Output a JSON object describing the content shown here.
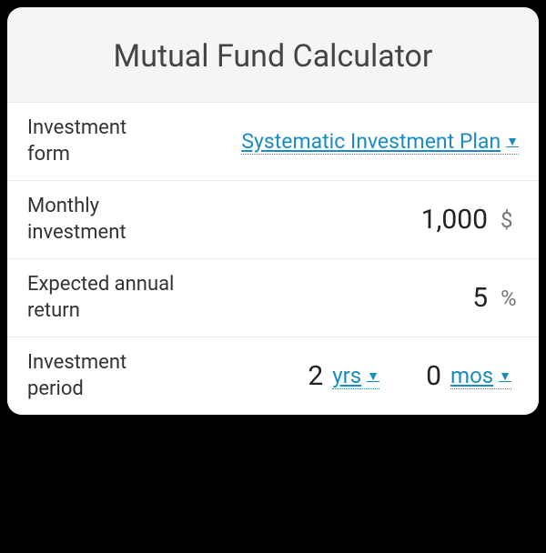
{
  "title": "Mutual Fund Calculator",
  "rows": {
    "form": {
      "label": "Investment form",
      "value": "Systematic Investment Plan"
    },
    "monthly": {
      "label": "Monthly investment",
      "value": "1,000",
      "unit": "$"
    },
    "return": {
      "label": "Expected annual return",
      "value": "5",
      "unit": "%"
    },
    "period": {
      "label": "Investment period",
      "years_value": "2",
      "years_unit": "yrs",
      "months_value": "0",
      "months_unit": "mos"
    }
  }
}
